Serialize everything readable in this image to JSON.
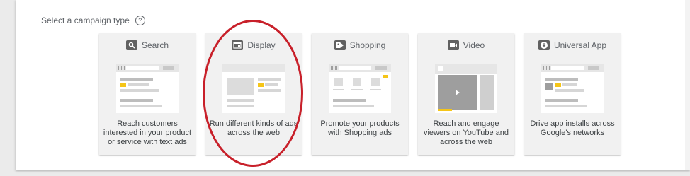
{
  "header": {
    "label": "Select a campaign type",
    "help_icon": "help-circle-icon",
    "help_glyph": "?"
  },
  "accent_colors": {
    "annotation": "#c8202a",
    "illustration_highlight": "#f5c518"
  },
  "campaign_types": [
    {
      "id": "search",
      "title": "Search",
      "icon": "search-icon",
      "description": "Reach customers interested in your product or service with text ads"
    },
    {
      "id": "display",
      "title": "Display",
      "icon": "display-icon",
      "description": "Run different kinds of ads across the web",
      "annotated": true
    },
    {
      "id": "shopping",
      "title": "Shopping",
      "icon": "tag-icon",
      "description": "Promote your products with Shopping ads"
    },
    {
      "id": "video",
      "title": "Video",
      "icon": "video-camera-icon",
      "description": "Reach and engage viewers on YouTube and across the web"
    },
    {
      "id": "universal-app",
      "title": "Universal App",
      "icon": "download-icon",
      "description": "Drive app installs across Google's networks"
    }
  ]
}
